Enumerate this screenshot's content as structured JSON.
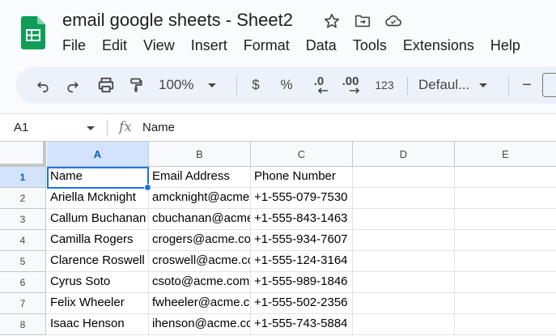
{
  "document": {
    "title": "email google sheets - Sheet2",
    "logo_icon": "google-sheets-logo",
    "title_icons": [
      "star-icon",
      "move-to-folder-icon",
      "cloud-saved-icon"
    ]
  },
  "menubar": {
    "items": [
      "File",
      "Edit",
      "View",
      "Insert",
      "Format",
      "Data",
      "Tools",
      "Extensions",
      "Help"
    ]
  },
  "toolbar": {
    "undo_icon": "undo-icon",
    "redo_icon": "redo-icon",
    "print_icon": "print-icon",
    "paint_format_icon": "paint-format-icon",
    "zoom": "100%",
    "currency_label": "$",
    "percent_label": "%",
    "decrease_decimal_label": ".0",
    "increase_decimal_label": ".00",
    "more_formats_label": "123",
    "font_family": "Defaul...",
    "font_size_minus": "−"
  },
  "formula_bar": {
    "cell_ref": "A1",
    "fx_label": "fx",
    "content": "Name"
  },
  "grid": {
    "columns": [
      "A",
      "B",
      "C",
      "D",
      "E"
    ],
    "active_column": "A",
    "active_row": "1",
    "rows": [
      {
        "num": "1",
        "cells": [
          "Name",
          "Email Address",
          "Phone Number",
          "",
          ""
        ]
      },
      {
        "num": "2",
        "cells": [
          "Ariella Mcknight",
          "amcknight@acme.com",
          "+1-555-079-7530",
          "",
          ""
        ]
      },
      {
        "num": "3",
        "cells": [
          "Callum Buchanan",
          "cbuchanan@acme.com",
          "+1-555-843-1463",
          "",
          ""
        ]
      },
      {
        "num": "4",
        "cells": [
          "Camilla Rogers",
          "crogers@acme.com",
          "+1-555-934-7607",
          "",
          ""
        ]
      },
      {
        "num": "5",
        "cells": [
          "Clarence Roswell",
          "croswell@acme.com",
          "+1-555-124-3164",
          "",
          ""
        ]
      },
      {
        "num": "6",
        "cells": [
          "Cyrus Soto",
          "csoto@acme.com",
          "+1-555-989-1846",
          "",
          ""
        ]
      },
      {
        "num": "7",
        "cells": [
          "Felix Wheeler",
          "fwheeler@acme.com",
          "+1-555-502-2356",
          "",
          ""
        ]
      },
      {
        "num": "8",
        "cells": [
          "Isaac Henson",
          "ihenson@acme.com",
          "+1-555-743-5884",
          "",
          ""
        ]
      }
    ]
  },
  "colors": {
    "accent": "#1a73e8",
    "toolbar_bg": "#edf2fa",
    "sheets_green": "#0f9d58"
  }
}
